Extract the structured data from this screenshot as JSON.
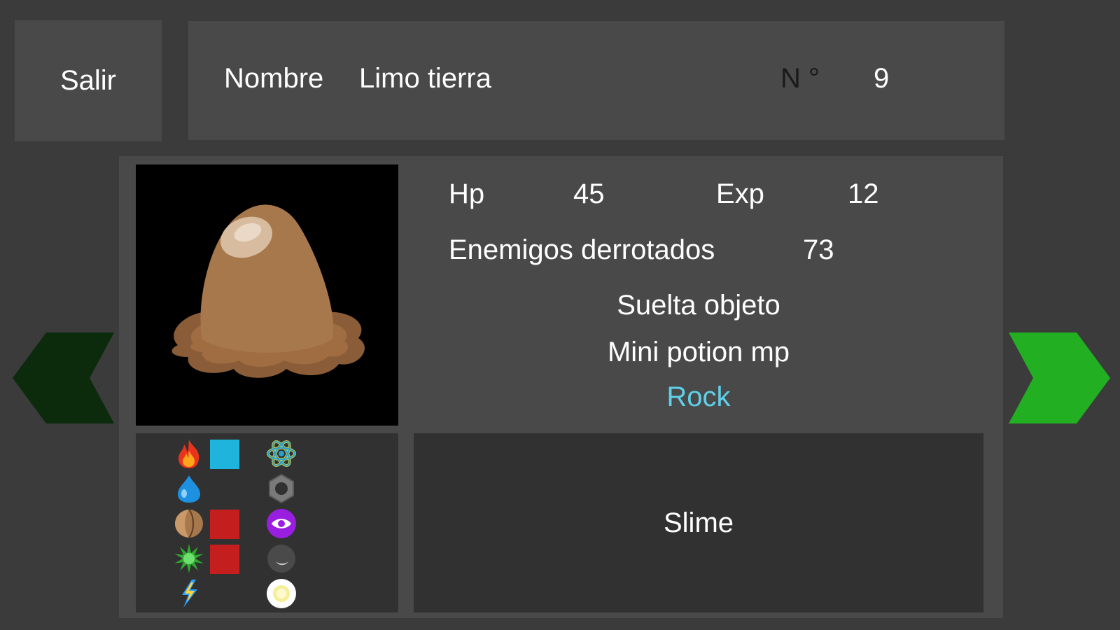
{
  "header": {
    "exit_label": "Salir",
    "name_label": "Nombre",
    "name_value": "Limo tierra",
    "number_label": "N °",
    "number_value": "9"
  },
  "stats": {
    "hp_label": "Hp",
    "hp_value": "45",
    "exp_label": "Exp",
    "exp_value": "12",
    "defeated_label": "Enemigos derrotados",
    "defeated_value": "73"
  },
  "drop": {
    "label": "Suelta objeto",
    "item": "Mini potion mp",
    "type": "Rock"
  },
  "description": "Slime",
  "colors": {
    "type_text": "#5fd0e8",
    "arrow_prev": "#0c2a0c",
    "arrow_next": "#22b022",
    "swatch_blue": "#1fb4dc",
    "swatch_red": "#c41e1e"
  },
  "elements": {
    "left": [
      "fire-icon",
      "water-drop-icon",
      "earth-icon",
      "nature-icon",
      "lightning-icon"
    ],
    "swatches": [
      "blue",
      "none",
      "red",
      "red",
      "none"
    ],
    "right": [
      "atom-icon",
      "hex-nut-icon",
      "eye-icon",
      "moon-icon",
      "sun-icon"
    ]
  }
}
